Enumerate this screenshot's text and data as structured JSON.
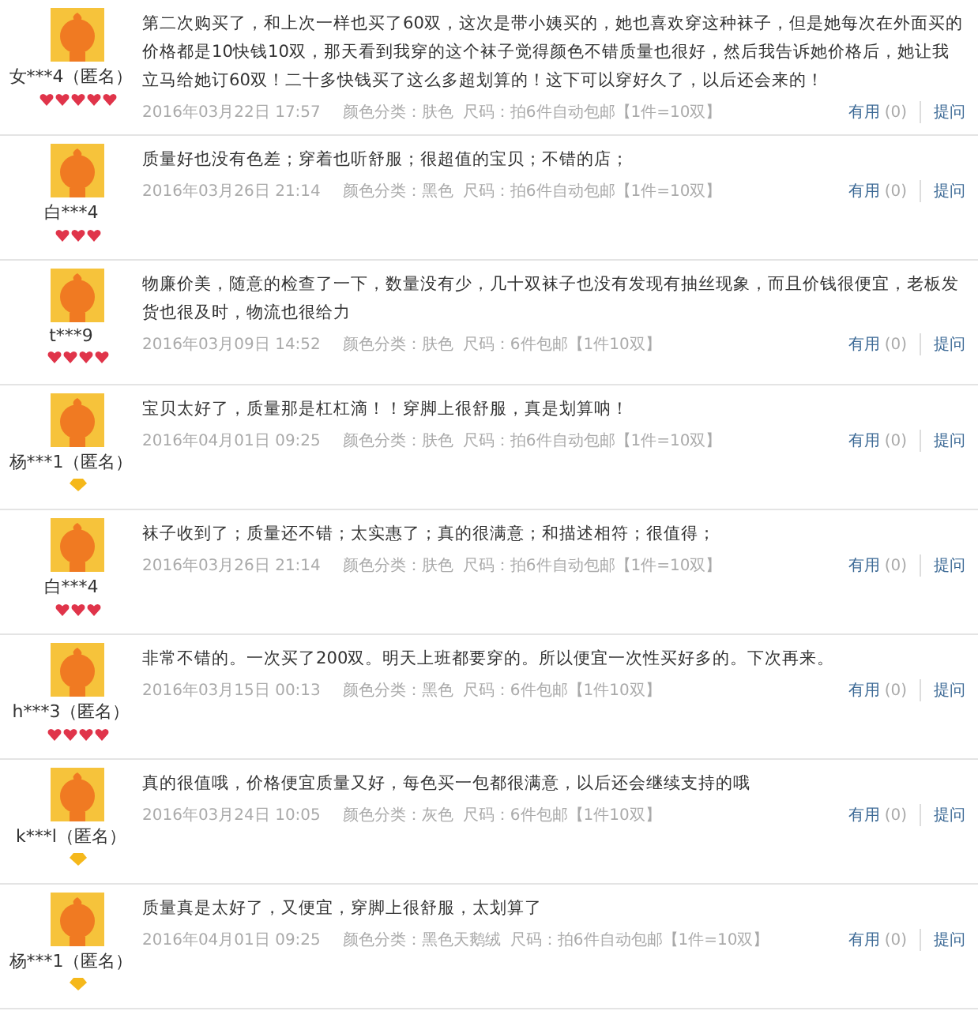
{
  "reviews": [
    {
      "user": "女***4（匿名）",
      "rank": {
        "kind": "heart",
        "stars": 5
      },
      "text": "第二次购买了，和上次一样也买了60双，这次是带小姨买的，她也喜欢穿这种袜子，但是她每次在外面买的价格都是10快钱10双，那天看到我穿的这个袜子觉得颜色不错质量也很好，然后我告诉她价格后，她让我立马给她订60双！二十多快钱买了这么多超划算的！这下可以穿好久了，以后还会来的！",
      "date": "2016年03月22日 17:57",
      "color_option": "颜色分类：肤色",
      "size": "尺码：拍6件自动包邮【1件=10双】",
      "useful": "有用",
      "useful_count": "(0)",
      "ask": "提问"
    },
    {
      "user": "白***4",
      "rank": {
        "kind": "heart",
        "stars": 3
      },
      "text": "质量好也没有色差；穿着也听舒服；很超值的宝贝；不错的店；",
      "date": "2016年03月26日 21:14",
      "color_option": "颜色分类：黑色",
      "size": "尺码：拍6件自动包邮【1件=10双】",
      "useful": "有用",
      "useful_count": "(0)",
      "ask": "提问"
    },
    {
      "user": "t***9",
      "rank": {
        "kind": "heart",
        "stars": 4
      },
      "text": "物廉价美，随意的检查了一下，数量没有少，几十双袜子也没有发现有抽丝现象，而且价钱很便宜，老板发货也很及时，物流也很给力",
      "date": "2016年03月09日 14:52",
      "color_option": "颜色分类：肤色",
      "size": "尺码：6件包邮【1件10双】",
      "useful": "有用",
      "useful_count": "(0)",
      "ask": "提问"
    },
    {
      "user": "杨***1（匿名）",
      "rank": {
        "kind": "diamond"
      },
      "text": "宝贝太好了，质量那是杠杠滴！！穿脚上很舒服，真是划算呐！",
      "date": "2016年04月01日 09:25",
      "color_option": "颜色分类：肤色",
      "size": "尺码：拍6件自动包邮【1件=10双】",
      "useful": "有用",
      "useful_count": "(0)",
      "ask": "提问"
    },
    {
      "user": "白***4",
      "rank": {
        "kind": "heart",
        "stars": 3
      },
      "text": "袜子收到了；质量还不错；太实惠了；真的很满意；和描述相符；很值得；",
      "date": "2016年03月26日 21:14",
      "color_option": "颜色分类：肤色",
      "size": "尺码：拍6件自动包邮【1件=10双】",
      "useful": "有用",
      "useful_count": "(0)",
      "ask": "提问"
    },
    {
      "user": "h***3（匿名）",
      "rank": {
        "kind": "heart",
        "stars": 4
      },
      "text": "非常不错的。一次买了200双。明天上班都要穿的。所以便宜一次性买好多的。下次再来。",
      "date": "2016年03月15日 00:13",
      "color_option": "颜色分类：黑色",
      "size": "尺码：6件包邮【1件10双】",
      "useful": "有用",
      "useful_count": "(0)",
      "ask": "提问"
    },
    {
      "user": "k***l（匿名）",
      "rank": {
        "kind": "diamond"
      },
      "text": "真的很值哦，价格便宜质量又好，每色买一包都很满意，以后还会继续支持的哦",
      "date": "2016年03月24日 10:05",
      "color_option": "颜色分类：灰色",
      "size": "尺码：6件包邮【1件10双】",
      "useful": "有用",
      "useful_count": "(0)",
      "ask": "提问"
    },
    {
      "user": "杨***1（匿名）",
      "rank": {
        "kind": "diamond"
      },
      "text": "质量真是太好了，又便宜，穿脚上很舒服，太划算了",
      "date": "2016年04月01日 09:25",
      "color_option": "颜色分类：黑色天鹅绒",
      "size": "尺码：拍6件自动包邮【1件=10双】",
      "useful": "有用",
      "useful_count": "(0)",
      "ask": "提问"
    }
  ]
}
